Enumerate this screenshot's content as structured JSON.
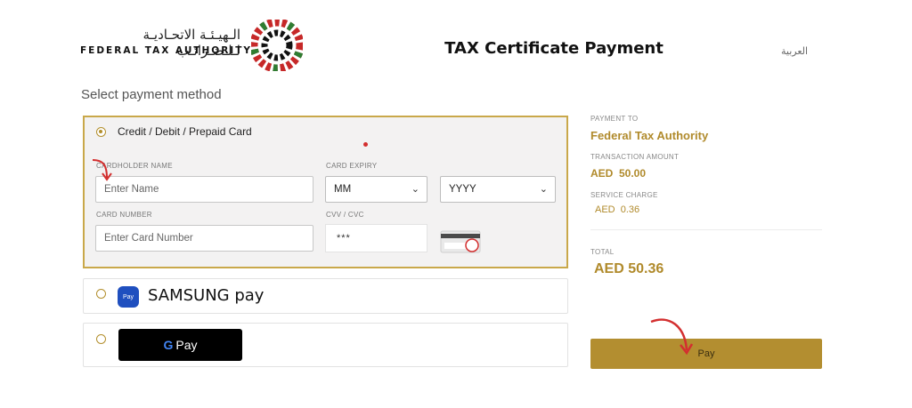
{
  "header": {
    "logo_arabic": "الـهيـئـة الاتحـاديـة لـلـضـرائـب",
    "logo_english": "FEDERAL TAX AUTHORITY",
    "title": "TAX Certificate Payment",
    "language_toggle": "العربية"
  },
  "payment": {
    "section_title": "Select payment method",
    "card_option": {
      "label": "Credit / Debit / Prepaid Card",
      "cardholder_label": "CARDHOLDER NAME",
      "cardholder_placeholder": "Enter Name",
      "expiry_label": "CARD EXPIRY",
      "month_value": "MM",
      "year_value": "YYYY",
      "card_number_label": "CARD NUMBER",
      "card_number_placeholder": "Enter Card Number",
      "cvv_label": "CVV / CVC",
      "cvv_value": "***"
    },
    "samsung_pay": {
      "label": "SAMSUNG pay",
      "icon_text": "Pay"
    },
    "google_pay": {
      "label": "Pay",
      "g": "G"
    }
  },
  "summary": {
    "payment_to_label": "PAYMENT TO",
    "payment_to_value": "Federal Tax Authority",
    "transaction_label": "TRANSACTION AMOUNT",
    "transaction_value": "AED  50.00",
    "service_label": "SERVICE CHARGE",
    "service_value": "AED  0.36",
    "total_label": "TOTAL",
    "total_value": "AED 50.36",
    "pay_button": "Pay"
  },
  "colors": {
    "accent_gold": "#b38e30",
    "selected_border": "#c9a84a",
    "annotation_red": "#d32f2f"
  }
}
